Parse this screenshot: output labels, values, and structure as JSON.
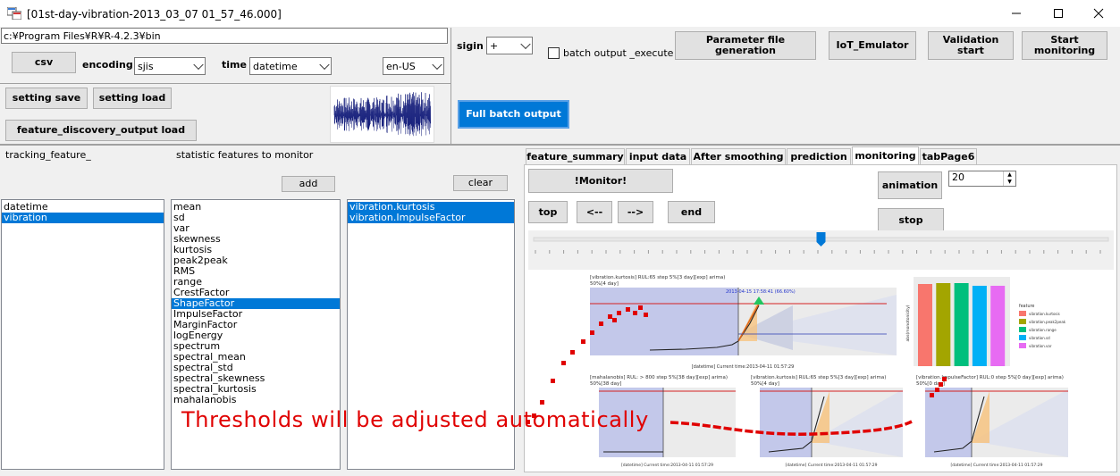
{
  "window": {
    "title": "[01st-day-vibration-2013_03_07 01_57_46.000]"
  },
  "toolbar": {
    "path_value": "c:¥Program Files¥R¥R-4.2.3¥bin",
    "csv_label": "csv",
    "encoding_label": "encoding",
    "encoding_value": "sjis",
    "time_label": "time",
    "time_value": "datetime",
    "locale_value": "en-US",
    "setting_save_label": "setting save",
    "setting_load_label": "setting load",
    "feature_discovery_label": "feature_discovery_output load",
    "sigin_label": "sigin",
    "sigin_value": "+",
    "batch_label": "batch output _execute",
    "param_label": "Parameter file generation",
    "iot_label": "IoT_Emulator",
    "validation_label": "Validation start",
    "start_label": "Start monitoring",
    "full_batch_label": "Full batch output"
  },
  "left": {
    "tracking_label": "tracking_feature_",
    "statistic_label": "statistic features to monitor",
    "add_label": "add",
    "clear_label": "clear",
    "tracking_items": [
      "datetime",
      "vibration"
    ],
    "tracking_selected": 1,
    "stat_items": [
      "mean",
      "sd",
      "var",
      "skewness",
      "kurtosis",
      "peak2peak",
      "RMS",
      "range",
      "CrestFactor",
      "ShapeFactor",
      "ImpulseFactor",
      "MarginFactor",
      "logEnergy",
      "spectrum",
      "spectral_mean",
      "spectral_std",
      "spectral_skewness",
      "spectral_kurtosis",
      "mahalanobis"
    ],
    "stat_selected": 9,
    "monitor_items": [
      "vibration.kurtosis",
      "vibration.ImpulseFactor"
    ]
  },
  "tabs": [
    "feature_summary",
    "input data",
    "After smoothing",
    "prediction",
    "monitoring",
    "tabPage6"
  ],
  "active_tab": 4,
  "monitor": {
    "monitor_btn": "!Monitor!",
    "top_btn": "top",
    "prev_btn": "<--",
    "next_btn": "-->",
    "end_btn": "end",
    "animation_btn": "animation",
    "stop_btn": "stop",
    "speed_value": "20",
    "slider_pos": 0.5
  },
  "charts": {
    "main_title": "[vibration.kurtosis] RUL:65 step 5%[3 day][exp] arima)",
    "main_sub": "50%[4 day]",
    "main_annot": "2013-04-15 17:58:41 (66.60%)",
    "main_xlabel": "[datetime] Current time:2013-04-11 01:57:29",
    "c1_title": "[mahalanobis] RUL: > 800 step 5%[38 day][exp] arima)",
    "c1_sub": "50%[38 day]",
    "c1_xlabel": "[datetime] Current time:2013-04-11 01:57:29",
    "c2_title": "[vibration.kurtosis] RUL:65 step 5%[3 day][exp] arima)",
    "c2_sub": "50%[4 day]",
    "c2_xlabel": "[datetime] Current time:2013-04-11 01:57:29",
    "c3_title": "[vibration.ImpulseFactor] RUL:0 step 5%[0 day][exp] arima)",
    "c3_sub": "50%[0 day]",
    "c3_xlabel": "[datetime] Current time:2013-04-11 01:57:29",
    "bar_ylabel": "abs(monotonicity)",
    "legend_title": "feature",
    "legend": [
      {
        "name": "vibration.kurtosis",
        "color": "#f8766d"
      },
      {
        "name": "vibration.peak2peak",
        "color": "#a3a500"
      },
      {
        "name": "vibration.range",
        "color": "#00bf7d"
      },
      {
        "name": "vibration.sd",
        "color": "#00b0f6"
      },
      {
        "name": "vibration.var",
        "color": "#e76bf3"
      }
    ],
    "bar_values": [
      0.92,
      0.93,
      0.93,
      0.9,
      0.9
    ]
  },
  "overlay_text": "Thresholds will be adjusted automatically"
}
